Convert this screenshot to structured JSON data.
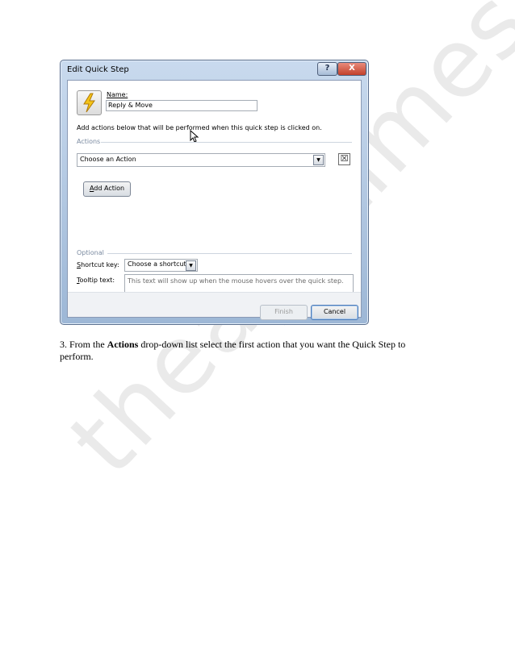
{
  "watermark": "theapptimes.com",
  "dialog": {
    "title": "Edit Quick Step",
    "help_glyph": "?",
    "close_glyph": "X",
    "name_label": "Name:",
    "name_value": "Reply & Move",
    "description": "Add actions below that will be performed when this quick step is clicked on.",
    "actions_section": "Actions",
    "action_select_value": "Choose an Action",
    "delete_glyph": "☒",
    "add_action_button": {
      "mnemonic": "A",
      "rest": "dd Action"
    },
    "optional_section": "Optional",
    "shortcut_label": {
      "mnemonic": "S",
      "rest": "hortcut key:"
    },
    "shortcut_value": "Choose a shortcut",
    "tooltip_label": {
      "mnemonic": "T",
      "rest": "ooltip text:"
    },
    "tooltip_placeholder": "This text will show up when the mouse hovers over the quick step.",
    "finish_button": "Finish",
    "cancel_button": "Cancel"
  },
  "caption": {
    "prefix": "3. From the ",
    "bold": "Actions",
    "suffix": " drop-down list select the first action that you want the Quick Step to perform."
  },
  "colors": {
    "title_gradient_top": "#c9daee",
    "close_button": "#c2412b",
    "section_label": "#7a8aa0"
  }
}
